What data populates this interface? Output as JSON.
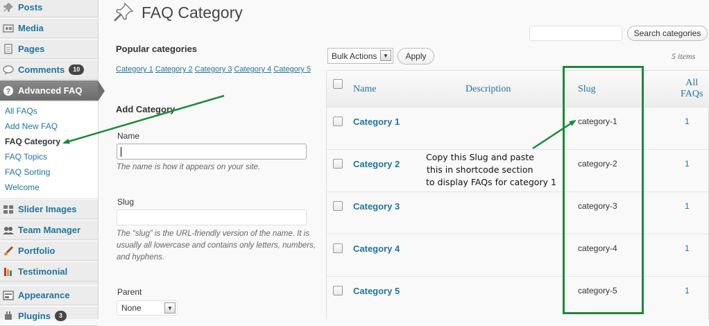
{
  "sidebar": {
    "menu": [
      {
        "label": "Posts",
        "icon": "pushpin-icon"
      },
      {
        "label": "Media",
        "icon": "media-icon"
      },
      {
        "label": "Pages",
        "icon": "pages-icon"
      },
      {
        "label": "Comments",
        "icon": "comment-icon",
        "badge": "10"
      },
      {
        "label": "Advanced FAQ",
        "icon": "question-icon"
      },
      {
        "label": "Slider Images",
        "icon": "grid-icon"
      },
      {
        "label": "Team Manager",
        "icon": "users-icon"
      },
      {
        "label": "Portfolio",
        "icon": "brush-icon"
      },
      {
        "label": "Testimonial",
        "icon": "testimonial-icon"
      },
      {
        "label": "Appearance",
        "icon": "appearance-icon"
      },
      {
        "label": "Plugins",
        "icon": "plugin-icon",
        "badge": "3"
      }
    ],
    "submenu": [
      "All FAQs",
      "Add New FAQ",
      "FAQ Category",
      "FAQ Topics",
      "FAQ Sorting",
      "Welcome"
    ],
    "current_submenu": "FAQ Category"
  },
  "header": {
    "title": "FAQ Category",
    "search_button": "Search categories"
  },
  "form": {
    "popular_title": "Popular categories",
    "popular_links": [
      "Category 1",
      "Category 2",
      "Category 3",
      "Category 4",
      "Category 5"
    ],
    "add_title": "Add Category",
    "name_label": "Name",
    "name_help": "The name is how it appears on your site.",
    "slug_label": "Slug",
    "slug_help": "The “slug” is the URL-friendly version of the name. It is usually all lowercase and contains only letters, numbers, and hyphens.",
    "parent_label": "Parent",
    "parent_value": "None"
  },
  "table": {
    "bulk_actions": "Bulk Actions",
    "apply": "Apply",
    "items_count": "5 items",
    "columns": {
      "name": "Name",
      "description": "Description",
      "slug": "Slug",
      "faqs_line1": "All",
      "faqs_line2": "FAQs"
    },
    "rows": [
      {
        "name": "Category 1",
        "slug": "category-1",
        "count": "1"
      },
      {
        "name": "Category 2",
        "slug": "category-2",
        "count": "1"
      },
      {
        "name": "Category 3",
        "slug": "category-3",
        "count": "1"
      },
      {
        "name": "Category 4",
        "slug": "category-4",
        "count": "1"
      },
      {
        "name": "Category 5",
        "slug": "category-5",
        "count": "1"
      }
    ]
  },
  "annotation": {
    "lines": [
      "Copy this Slug and paste",
      "this in shortcode section",
      "to display FAQs for category 1"
    ],
    "color": "#1a8a3a"
  },
  "colors": {
    "link": "#21759b",
    "menu_active": "#6d6d6d",
    "annotation": "#1a8a3a"
  }
}
